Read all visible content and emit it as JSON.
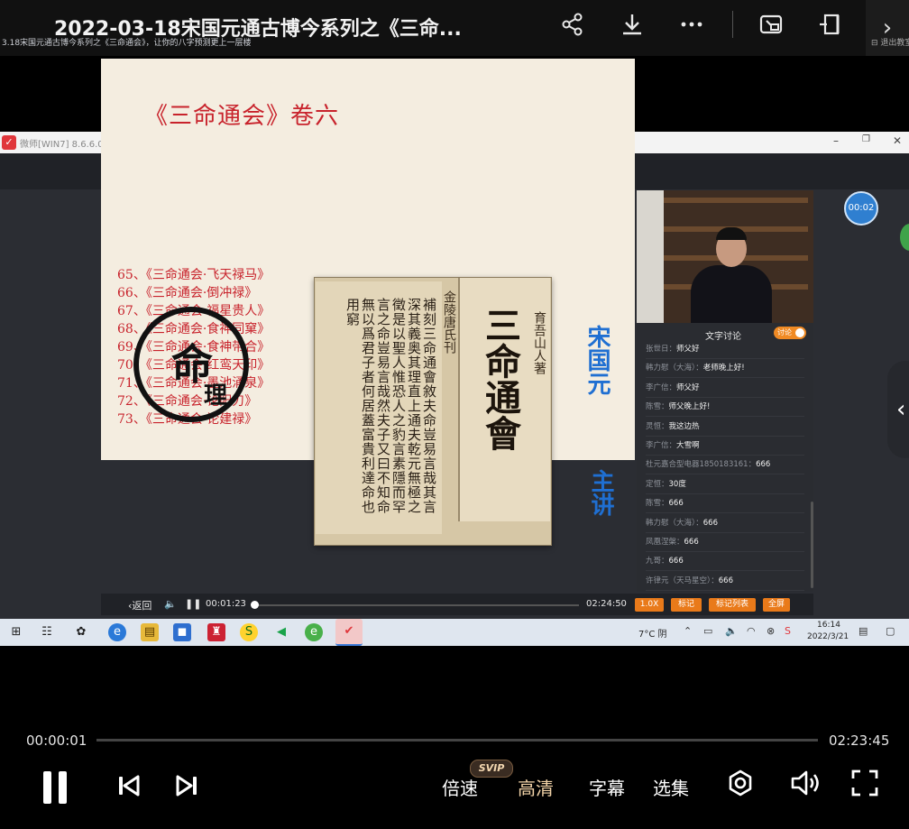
{
  "top_bar": {
    "title": "2022-03-18宋国元通古博今系列之《三命...",
    "icons": [
      "share-icon",
      "download-icon",
      "more-icon",
      "screen-cast-icon",
      "pip-icon",
      "chevron-right-icon"
    ]
  },
  "inner_window": {
    "title": "微师[WIN7] 8.6.6.0407",
    "course_title": "3.18宋国元通古博今系列之《三命通会》，让你的八字预测更上一层楼",
    "exit_label": "退出教室",
    "controls": {
      "minimize": "–",
      "restore": "❐",
      "close": "✕"
    }
  },
  "slide": {
    "header": "《三命通会》卷六",
    "chapters": [
      "65、《三命通会·飞天禄马》",
      "66、《三命通会·倒冲禄》",
      "67、《三命通会·福星贵人》",
      "68、《三命通会·食神同窠》",
      "69、《三命通会·食神带合》",
      "70、《三命通会·红鸾天印》",
      "71、《三命通会·墨池涌泉》",
      "72、《三命通会·论阳刃》",
      "73、《三命通会·论建禄》"
    ],
    "seal_text_1": "命",
    "seal_text_2": "理",
    "book_text": "補刻三命通會敘夫命豈易言哉其言深其義奥其理直上通夫乾元無極之徵是以聖人惟恐人之豹言素隱而罕言之命豈易言哉然夫子又曰不知命無以爲君子者何居蓋富貴利達命也用窮",
    "book_side": "金陵唐氏刊",
    "book_big": "三命通會",
    "book_author": "育吾山人著",
    "host_name": "宋国元",
    "host_role": "主讲"
  },
  "chat": {
    "title": "文字讨论",
    "toggle_label": "讨论",
    "messages": [
      {
        "user": "张世日：",
        "text": "师父好"
      },
      {
        "user": "韩力慰（大海）：",
        "text": "老师晚上好!"
      },
      {
        "user": "李广信：",
        "text": "师父好"
      },
      {
        "user": "陈雪：",
        "text": "师父晚上好!"
      },
      {
        "user": "灵恒：",
        "text": "我这边热"
      },
      {
        "user": "李广信：",
        "text": "大雪啊"
      },
      {
        "user": "杜元嘉合型电器18501831​61：",
        "text": "666"
      },
      {
        "user": "定恒：",
        "text": "30度"
      },
      {
        "user": "陈雪：",
        "text": "666"
      },
      {
        "user": "韩力慰（大海）：",
        "text": "666"
      },
      {
        "user": "凤凰涅槃：",
        "text": "666"
      },
      {
        "user": "九哥：",
        "text": "666"
      },
      {
        "user": "许律元（天马星空）：",
        "text": "666"
      }
    ]
  },
  "inner_player": {
    "back_label": "返回",
    "current_time": "00:01:23",
    "total_time": "02:24:50",
    "progress": 0.01,
    "speed_label": "1.0X",
    "mark_label": "标记",
    "mark_list_label": "标记列表",
    "fullscreen_label": "全屏"
  },
  "taskbar": {
    "weather": "7°C 阴",
    "time": "16:14",
    "date": "2022/3/21"
  },
  "timer_badge": "00:02",
  "player": {
    "current_time": "00:00:01",
    "duration": "02:23:45",
    "progress": 0.0,
    "speed_label": "倍速",
    "quality_label": "高清",
    "svip_badge": "SVIP",
    "subtitle_label": "字幕",
    "episodes_label": "选集"
  }
}
